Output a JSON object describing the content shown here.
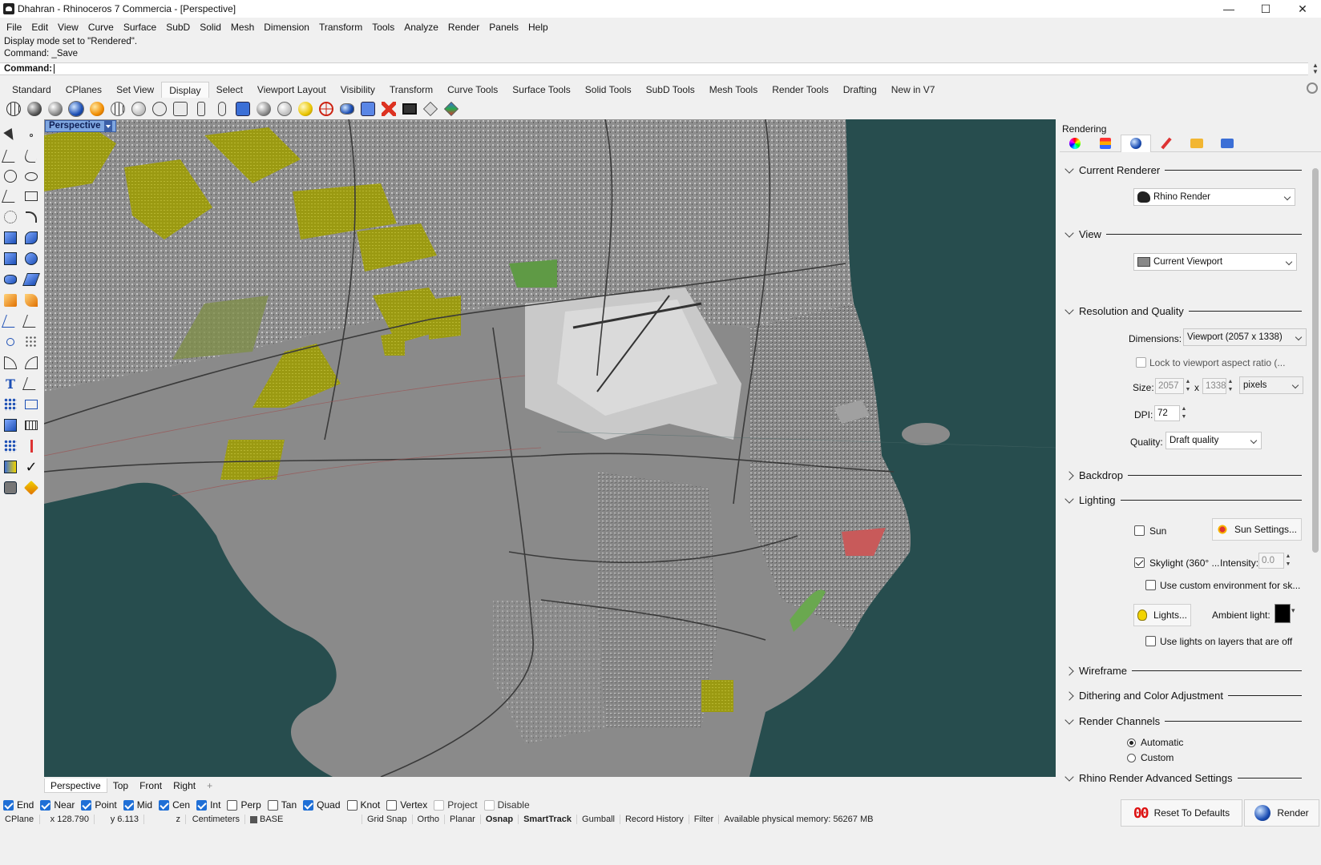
{
  "window": {
    "title": "Dhahran - Rhinoceros 7 Commercia - [Perspective]",
    "minimize": "—",
    "maximize": "☐",
    "close": "✕"
  },
  "menu": [
    "File",
    "Edit",
    "View",
    "Curve",
    "Surface",
    "SubD",
    "Solid",
    "Mesh",
    "Dimension",
    "Transform",
    "Tools",
    "Analyze",
    "Render",
    "Panels",
    "Help"
  ],
  "command": {
    "history": [
      "Display mode set to \"Rendered\".",
      "Command: _Save"
    ],
    "prompt": "Command:"
  },
  "toolbar_tabs": [
    "Standard",
    "CPlanes",
    "Set View",
    "Display",
    "Select",
    "Viewport Layout",
    "Visibility",
    "Transform",
    "Curve Tools",
    "Surface Tools",
    "Solid Tools",
    "SubD Tools",
    "Mesh Tools",
    "Render Tools",
    "Drafting",
    "New in V7"
  ],
  "toolbar_active_tab": "Display",
  "toolbar_icons": [
    "wireframe-icon",
    "shaded-icon",
    "shaded-icon",
    "rendered-icon",
    "rendered-icon",
    "ghosted-icon",
    "xray-icon",
    "technical-icon",
    "artistic-icon",
    "pen-icon",
    "arctic-icon",
    "raytraced-icon",
    "monochrome-icon",
    "lighting-icon",
    "sun-icon",
    "cplane-icon",
    "render-preview-icon",
    "zebra-icon",
    "remove-icon",
    "monitor-icon",
    "box-icon",
    "color-cube-icon"
  ],
  "viewport": {
    "label": "Perspective",
    "tabs": [
      "Perspective",
      "Top",
      "Front",
      "Right"
    ],
    "active_tab": "Perspective",
    "add_tab": "+",
    "water_color": "#274d4e",
    "land_color": "#8c8c8c"
  },
  "osnap": [
    {
      "label": "End",
      "checked": true
    },
    {
      "label": "Near",
      "checked": true
    },
    {
      "label": "Point",
      "checked": true
    },
    {
      "label": "Mid",
      "checked": true
    },
    {
      "label": "Cen",
      "checked": true
    },
    {
      "label": "Int",
      "checked": true
    },
    {
      "label": "Perp",
      "checked": false
    },
    {
      "label": "Tan",
      "checked": false
    },
    {
      "label": "Quad",
      "checked": true
    },
    {
      "label": "Knot",
      "checked": false
    },
    {
      "label": "Vertex",
      "checked": false
    },
    {
      "label": "Project",
      "checked": false
    },
    {
      "label": "Disable",
      "checked": false
    }
  ],
  "status": {
    "cplane": "CPlane",
    "x": "x 128.790",
    "y": "y 6.113",
    "z": "z",
    "units": "Centimeters",
    "layer": "BASE",
    "grid_snap": "Grid Snap",
    "ortho": "Ortho",
    "planar": "Planar",
    "osnap": "Osnap",
    "smarttrack": "SmartTrack",
    "gumball": "Gumball",
    "record_history": "Record History",
    "filter": "Filter",
    "memory": "Available physical memory: 56267 MB"
  },
  "panel": {
    "title": "Rendering",
    "tabs": [
      "color-icon",
      "layers-icon",
      "render-icon",
      "pen-icon",
      "folder-icon",
      "view-icon"
    ],
    "current_renderer": {
      "header": "Current Renderer",
      "value": "Rhino Render"
    },
    "view": {
      "header": "View",
      "value": "Current Viewport"
    },
    "resolution": {
      "header": "Resolution and Quality",
      "dimensions_label": "Dimensions:",
      "dimensions_value": "Viewport (2057 x 1338)",
      "lock_label": "Lock to viewport aspect ratio (...",
      "size_label": "Size:",
      "width": "2057",
      "x": "x",
      "height": "1338",
      "units": "pixels",
      "dpi_label": "DPI:",
      "dpi": "72",
      "quality_label": "Quality:",
      "quality": "Draft quality"
    },
    "backdrop": {
      "header": "Backdrop"
    },
    "lighting": {
      "header": "Lighting",
      "sun_label": "Sun",
      "sun_checked": false,
      "sun_settings": "Sun Settings...",
      "skylight_label": "Skylight (360° ...",
      "skylight_checked": true,
      "intensity_label": "Intensity:",
      "intensity": "0.0",
      "custom_env_label": "Use custom environment for sk...",
      "lights_button": "Lights...",
      "ambient_label": "Ambient light:",
      "ambient_color": "#000000",
      "layers_off_label": "Use lights on layers that are off"
    },
    "wireframe": {
      "header": "Wireframe"
    },
    "dithering": {
      "header": "Dithering and Color Adjustment"
    },
    "channels": {
      "header": "Render Channels",
      "automatic": "Automatic",
      "custom": "Custom",
      "selected": "Automatic"
    },
    "advanced": {
      "header": "Rhino Render Advanced Settings"
    },
    "reset_button": "Reset To Defaults",
    "render_button": "Render"
  }
}
